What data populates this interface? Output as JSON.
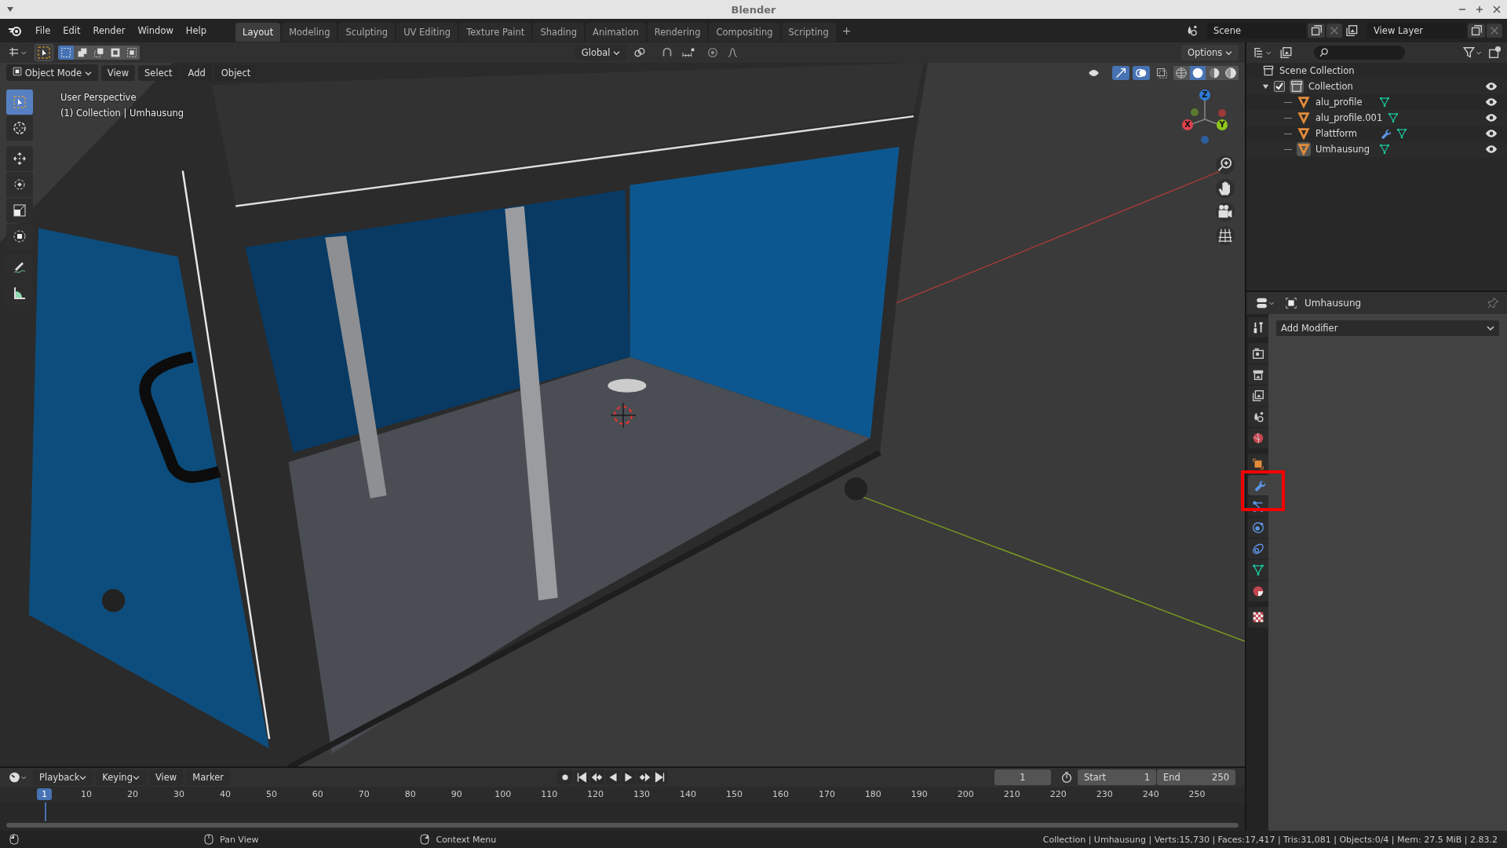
{
  "window": {
    "title": "Blender"
  },
  "menu": [
    "File",
    "Edit",
    "Render",
    "Window",
    "Help"
  ],
  "workspaces": [
    {
      "label": "Layout",
      "selected": true
    },
    {
      "label": "Modeling",
      "selected": false
    },
    {
      "label": "Sculpting",
      "selected": false
    },
    {
      "label": "UV Editing",
      "selected": false
    },
    {
      "label": "Texture Paint",
      "selected": false
    },
    {
      "label": "Shading",
      "selected": false
    },
    {
      "label": "Animation",
      "selected": false
    },
    {
      "label": "Rendering",
      "selected": false
    },
    {
      "label": "Compositing",
      "selected": false
    },
    {
      "label": "Scripting",
      "selected": false
    }
  ],
  "add_workspace": "+",
  "scene": {
    "name": "Scene"
  },
  "view_layer": {
    "name": "View Layer"
  },
  "tool_header": {
    "orientation": "Global",
    "options": "Options"
  },
  "viewport": {
    "mode": "Object Mode",
    "menus": [
      "View",
      "Select",
      "Add",
      "Object"
    ],
    "overlay_text": [
      "User Perspective",
      "(1) Collection | Umhausung"
    ],
    "tools": [
      {
        "kind": "select",
        "selected": true
      },
      {
        "kind": "cursor",
        "selected": false
      },
      {
        "kind": "move",
        "selected": false
      },
      {
        "kind": "rotate",
        "selected": false
      },
      {
        "kind": "scale",
        "selected": false
      },
      {
        "kind": "transform",
        "selected": false
      },
      {
        "kind": "annotate",
        "selected": false
      },
      {
        "kind": "measure",
        "selected": false
      }
    ],
    "shading": [
      {
        "kind": "wireframe",
        "selected": false
      },
      {
        "kind": "solid",
        "selected": true
      },
      {
        "kind": "material",
        "selected": false
      },
      {
        "kind": "rendered",
        "selected": false
      }
    ],
    "gizmo_axes": [
      {
        "label": "Z",
        "color": "#2e7bd6"
      },
      {
        "label": "X",
        "color": "#e0414e"
      },
      {
        "label": "Y",
        "color": "#8fc41c"
      }
    ]
  },
  "outliner": {
    "root": "Scene Collection",
    "collection": {
      "name": "Collection",
      "expanded": true,
      "checked": true,
      "children": [
        {
          "name": "alu_profile",
          "active": false,
          "has_modifier": false
        },
        {
          "name": "alu_profile.001",
          "active": false,
          "has_modifier": false
        },
        {
          "name": "Plattform",
          "active": false,
          "has_modifier": true
        },
        {
          "name": "Umhausung",
          "active": true,
          "has_modifier": false
        }
      ]
    }
  },
  "properties": {
    "object": "Umhausung",
    "add_modifier": "Add Modifier",
    "tabs": [
      {
        "kind": "tool",
        "selected": false,
        "highlighted": false
      },
      {
        "kind": "render",
        "selected": false,
        "highlighted": false
      },
      {
        "kind": "output",
        "selected": false,
        "highlighted": false
      },
      {
        "kind": "view_layer",
        "selected": false,
        "highlighted": false
      },
      {
        "kind": "scene",
        "selected": false,
        "highlighted": false
      },
      {
        "kind": "world",
        "selected": false,
        "highlighted": false
      },
      {
        "kind": "object",
        "selected": false,
        "highlighted": false
      },
      {
        "kind": "modifiers",
        "selected": true,
        "highlighted": true
      },
      {
        "kind": "particles",
        "selected": false,
        "highlighted": false
      },
      {
        "kind": "physics",
        "selected": false,
        "highlighted": false
      },
      {
        "kind": "constraints",
        "selected": false,
        "highlighted": false
      },
      {
        "kind": "data",
        "selected": false,
        "highlighted": false
      },
      {
        "kind": "material",
        "selected": false,
        "highlighted": false
      },
      {
        "kind": "texture",
        "selected": false,
        "highlighted": false
      }
    ]
  },
  "timeline": {
    "menus": [
      "Playback",
      "Keying",
      "View",
      "Marker"
    ],
    "current_frame": "1",
    "start_label": "Start",
    "start": "1",
    "end_label": "End",
    "end": "250",
    "playhead": "1",
    "ticks": [
      "10",
      "20",
      "30",
      "40",
      "50",
      "60",
      "70",
      "80",
      "90",
      "100",
      "110",
      "120",
      "130",
      "140",
      "150",
      "160",
      "170",
      "180",
      "190",
      "200",
      "210",
      "220",
      "230",
      "240",
      "250"
    ]
  },
  "status_bar": {
    "hints": [
      "Pan View",
      "Context Menu"
    ],
    "stats": "Collection | Umhausung | Verts:15,730 | Faces:17,417 | Tris:31,081 | Objects:0/4 | Mem: 27.5 MiB | 2.83.2"
  }
}
